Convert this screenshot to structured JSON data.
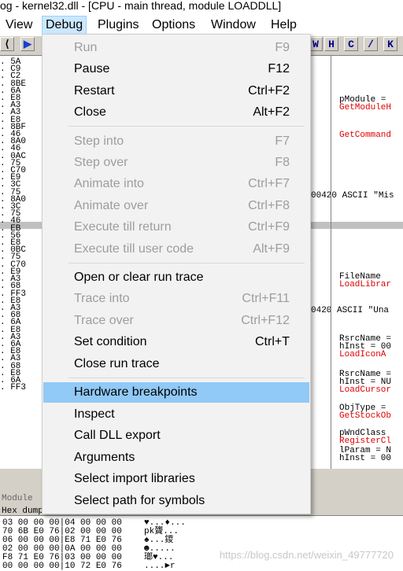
{
  "window": {
    "title": "og - kernel32.dll - [CPU - main thread, module LOADDLL]"
  },
  "menubar": {
    "items": [
      {
        "label": "View"
      },
      {
        "label": "Debug"
      },
      {
        "label": "Plugins"
      },
      {
        "label": "Options"
      },
      {
        "label": "Window"
      },
      {
        "label": "Help"
      }
    ]
  },
  "toolbar": {
    "letters": [
      "W",
      "H",
      "C",
      "/",
      "K"
    ]
  },
  "cpu": {
    "addr_lines": [
      "5A",
      "C9",
      "C2",
      "8BE",
      "6A",
      "E8",
      "A3",
      "A3",
      "E8",
      "8BF",
      "46",
      "8A0",
      "46",
      "0AC",
      "75",
      "C70",
      "E9",
      "3C",
      "75",
      "8A0",
      "3C",
      "75",
      "46",
      "EB",
      "56",
      "E8",
      "0BC",
      "75",
      "C70",
      "E9",
      "A3",
      "68",
      "FF3",
      "E8",
      "A3",
      "68",
      "6A",
      "E8",
      "A3",
      "6A",
      "E8",
      "A3",
      "68",
      "E8",
      "6A",
      "FF3"
    ],
    "ascii_missing": "00420  ASCII \"Mis",
    "ascii_unable": "0420  ASCII \"Una",
    "comments": [
      {
        "text": "pModule =",
        "red": false
      },
      {
        "text": "GetModuleH",
        "red": true
      },
      {
        "text": "GetCommand",
        "red": true
      },
      {
        "text": "FileName",
        "red": false
      },
      {
        "text": "LoadLibrar",
        "red": true
      },
      {
        "text": "RsrcName =",
        "red": false
      },
      {
        "text": "hInst = 00",
        "red": false
      },
      {
        "text": "LoadIconA",
        "red": true
      },
      {
        "text": "RsrcName =",
        "red": false
      },
      {
        "text": "hInst = NU",
        "red": false
      },
      {
        "text": "LoadCursor",
        "red": true
      },
      {
        "text": "ObjType =",
        "red": false
      },
      {
        "text": "GetStockOb",
        "red": true
      },
      {
        "text": "pWndClass",
        "red": false
      },
      {
        "text": "RegisterCl",
        "red": true
      },
      {
        "text": "lParam = N",
        "red": false
      },
      {
        "text": "hInst = 00",
        "red": false
      }
    ]
  },
  "bottom": {
    "module_label": "Module",
    "hex_header": "Hex dump",
    "dump_rows": [
      {
        "hex": "03 00 00 00|04 00 00 00",
        "ascii": "♥...♦..."
      },
      {
        "hex": "70 6B E0 76|02 00 00 00",
        "ascii": "pk䞄..."
      },
      {
        "hex": "06 00 00 00|E8 71 E0 76",
        "ascii": "♠...鑁"
      },
      {
        "hex": "02 00 00 00|0A 00 00 00",
        "ascii": "☻....."
      },
      {
        "hex": "F8 71 E0 76|03 00 00 00",
        "ascii": "瑯♥..."
      },
      {
        "hex": "00 00 00 00|10 72 E0 76",
        "ascii": "....►r"
      }
    ]
  },
  "watermark": "https://blog.csdn.net/weixin_49777720",
  "debug_menu": {
    "items": [
      {
        "label": "Run",
        "shortcut": "F9",
        "disabled": true
      },
      {
        "label": "Pause",
        "shortcut": "F12",
        "disabled": false
      },
      {
        "label": "Restart",
        "shortcut": "Ctrl+F2",
        "disabled": false
      },
      {
        "label": "Close",
        "shortcut": "Alt+F2",
        "disabled": false
      },
      {
        "label": "Step into",
        "shortcut": "F7",
        "disabled": true
      },
      {
        "label": "Step over",
        "shortcut": "F8",
        "disabled": true
      },
      {
        "label": "Animate into",
        "shortcut": "Ctrl+F7",
        "disabled": true
      },
      {
        "label": "Animate over",
        "shortcut": "Ctrl+F8",
        "disabled": true
      },
      {
        "label": "Execute till return",
        "shortcut": "Ctrl+F9",
        "disabled": true
      },
      {
        "label": "Execute till user code",
        "shortcut": "Alt+F9",
        "disabled": true
      },
      {
        "label": "Open or clear run trace",
        "shortcut": "",
        "disabled": false
      },
      {
        "label": "Trace into",
        "shortcut": "Ctrl+F11",
        "disabled": true
      },
      {
        "label": "Trace over",
        "shortcut": "Ctrl+F12",
        "disabled": true
      },
      {
        "label": "Set condition",
        "shortcut": "Ctrl+T",
        "disabled": false
      },
      {
        "label": "Close run trace",
        "shortcut": "",
        "disabled": false
      },
      {
        "label": "Hardware breakpoints",
        "shortcut": "",
        "disabled": false
      },
      {
        "label": "Inspect",
        "shortcut": "",
        "disabled": false
      },
      {
        "label": "Call DLL export",
        "shortcut": "",
        "disabled": false
      },
      {
        "label": "Arguments",
        "shortcut": "",
        "disabled": false
      },
      {
        "label": "Select import libraries",
        "shortcut": "",
        "disabled": false
      },
      {
        "label": "Select path for symbols",
        "shortcut": "",
        "disabled": false
      }
    ]
  }
}
